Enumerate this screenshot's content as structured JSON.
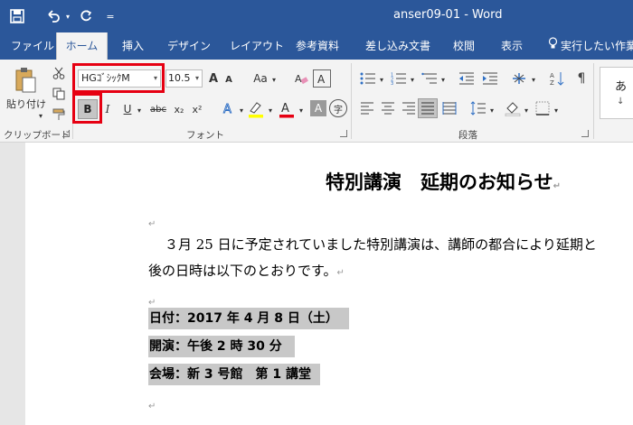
{
  "window": {
    "title": "anser09-01 - Word"
  },
  "quick_access": {
    "customize_label": "="
  },
  "tabs": [
    {
      "label": "ファイル",
      "active": false
    },
    {
      "label": "ホーム",
      "active": true
    },
    {
      "label": "挿入",
      "active": false
    },
    {
      "label": "デザイン",
      "active": false
    },
    {
      "label": "レイアウト",
      "active": false
    },
    {
      "label": "参考資料",
      "active": false
    },
    {
      "label": "差し込み文書",
      "active": false
    },
    {
      "label": "校閲",
      "active": false
    },
    {
      "label": "表示",
      "active": false
    },
    {
      "label": "実行したい作業",
      "active": false
    }
  ],
  "ribbon": {
    "clipboard": {
      "paste_label": "貼り付け",
      "group_label": "クリップボード"
    },
    "font": {
      "group_label": "フォント",
      "font_name": "HGｺﾞｼｯｸM",
      "font_size": "10.5",
      "grow_label": "A",
      "shrink_label": "A",
      "case_label": "Aa",
      "bold_label": "B",
      "italic_label": "I",
      "underline_label": "U",
      "strike_label": "abc",
      "sub_label": "x₂",
      "sup_label": "x²",
      "font_color_label": "A",
      "shading_label": "A",
      "enclose_label": "字"
    },
    "paragraph": {
      "group_label": "段落"
    },
    "styles": {
      "preview_text": "あ"
    }
  },
  "colors": {
    "accent": "#2b579a",
    "highlight": "#e60012",
    "selection": "#c8c8c8"
  },
  "document": {
    "title": "特別講演　延期のお知らせ",
    "body_line1": "３月 25 日に予定されていました特別講演は、講師の都合により延期と",
    "body_line2": "後の日時は以下のとおりです。",
    "details": [
      "日付：2017 年 4 月 8 日（土）",
      "開演：午後 2 時 30 分",
      "会場：新 3 号館　第 1 講堂"
    ],
    "return_mark": "↵"
  }
}
